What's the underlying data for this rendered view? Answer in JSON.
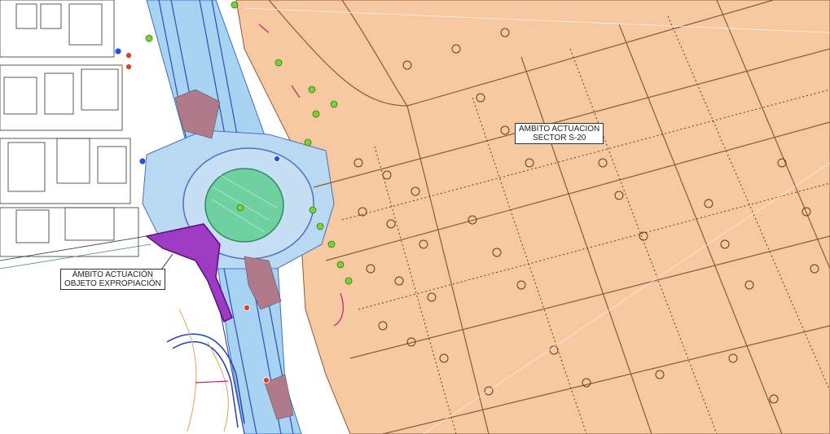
{
  "map": {
    "labels": {
      "sector": {
        "line1": "AMBITO ACTUACION",
        "line2": "SECTOR S-20"
      },
      "expropiacion": {
        "line1": "ÁMBITO ACTUACIÓN",
        "line2": "OBJETO EXPROPIACIÓN"
      }
    },
    "colors": {
      "sector_fill": "#f7c9a0",
      "parcel_line": "#8a5a3a",
      "road_blue": "#8fc4ee",
      "roundabout_green": "#6fd1a0",
      "expropiation_purple": "#7a1f9a",
      "median_pink": "#b07a8a",
      "tree_green": "#7ad13a",
      "sign_red": "#e04020"
    },
    "icons": [
      "tree-icon",
      "traffic-sign-icon"
    ]
  }
}
